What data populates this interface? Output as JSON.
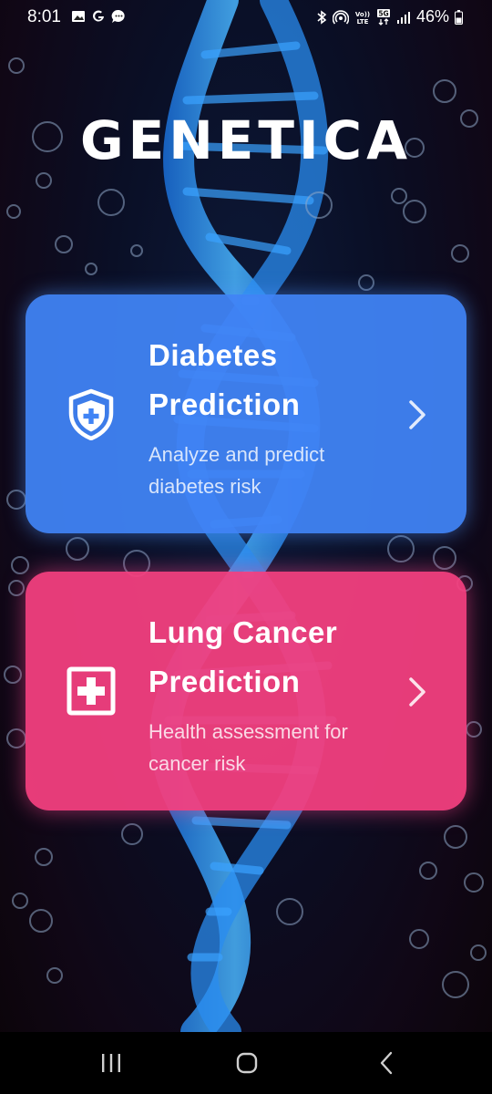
{
  "status_bar": {
    "time": "8:01",
    "battery": "46%",
    "left_icons": [
      "gallery-icon",
      "google-icon",
      "messages-icon"
    ],
    "right_icons": [
      "bluetooth-icon",
      "hotspot-icon",
      "volte-icon",
      "5g-icon",
      "signal-icon",
      "battery-icon"
    ]
  },
  "app": {
    "logo_text": "GENETICA"
  },
  "cards": [
    {
      "title_line1": "Diabetes",
      "title_line2": "Prediction",
      "subtitle_line1": "Analyze and predict",
      "subtitle_line2": "diabetes risk",
      "icon": "shield-plus-icon",
      "color": "#4184F5"
    },
    {
      "title_line1": "Lung Cancer",
      "title_line2": "Prediction",
      "subtitle_line1": "Health assessment for",
      "subtitle_line2": "cancer risk",
      "icon": "medical-cross-icon",
      "color": "#F44080"
    }
  ],
  "nav_bar": {
    "buttons": [
      "recent-apps-icon",
      "home-icon",
      "back-icon"
    ]
  }
}
